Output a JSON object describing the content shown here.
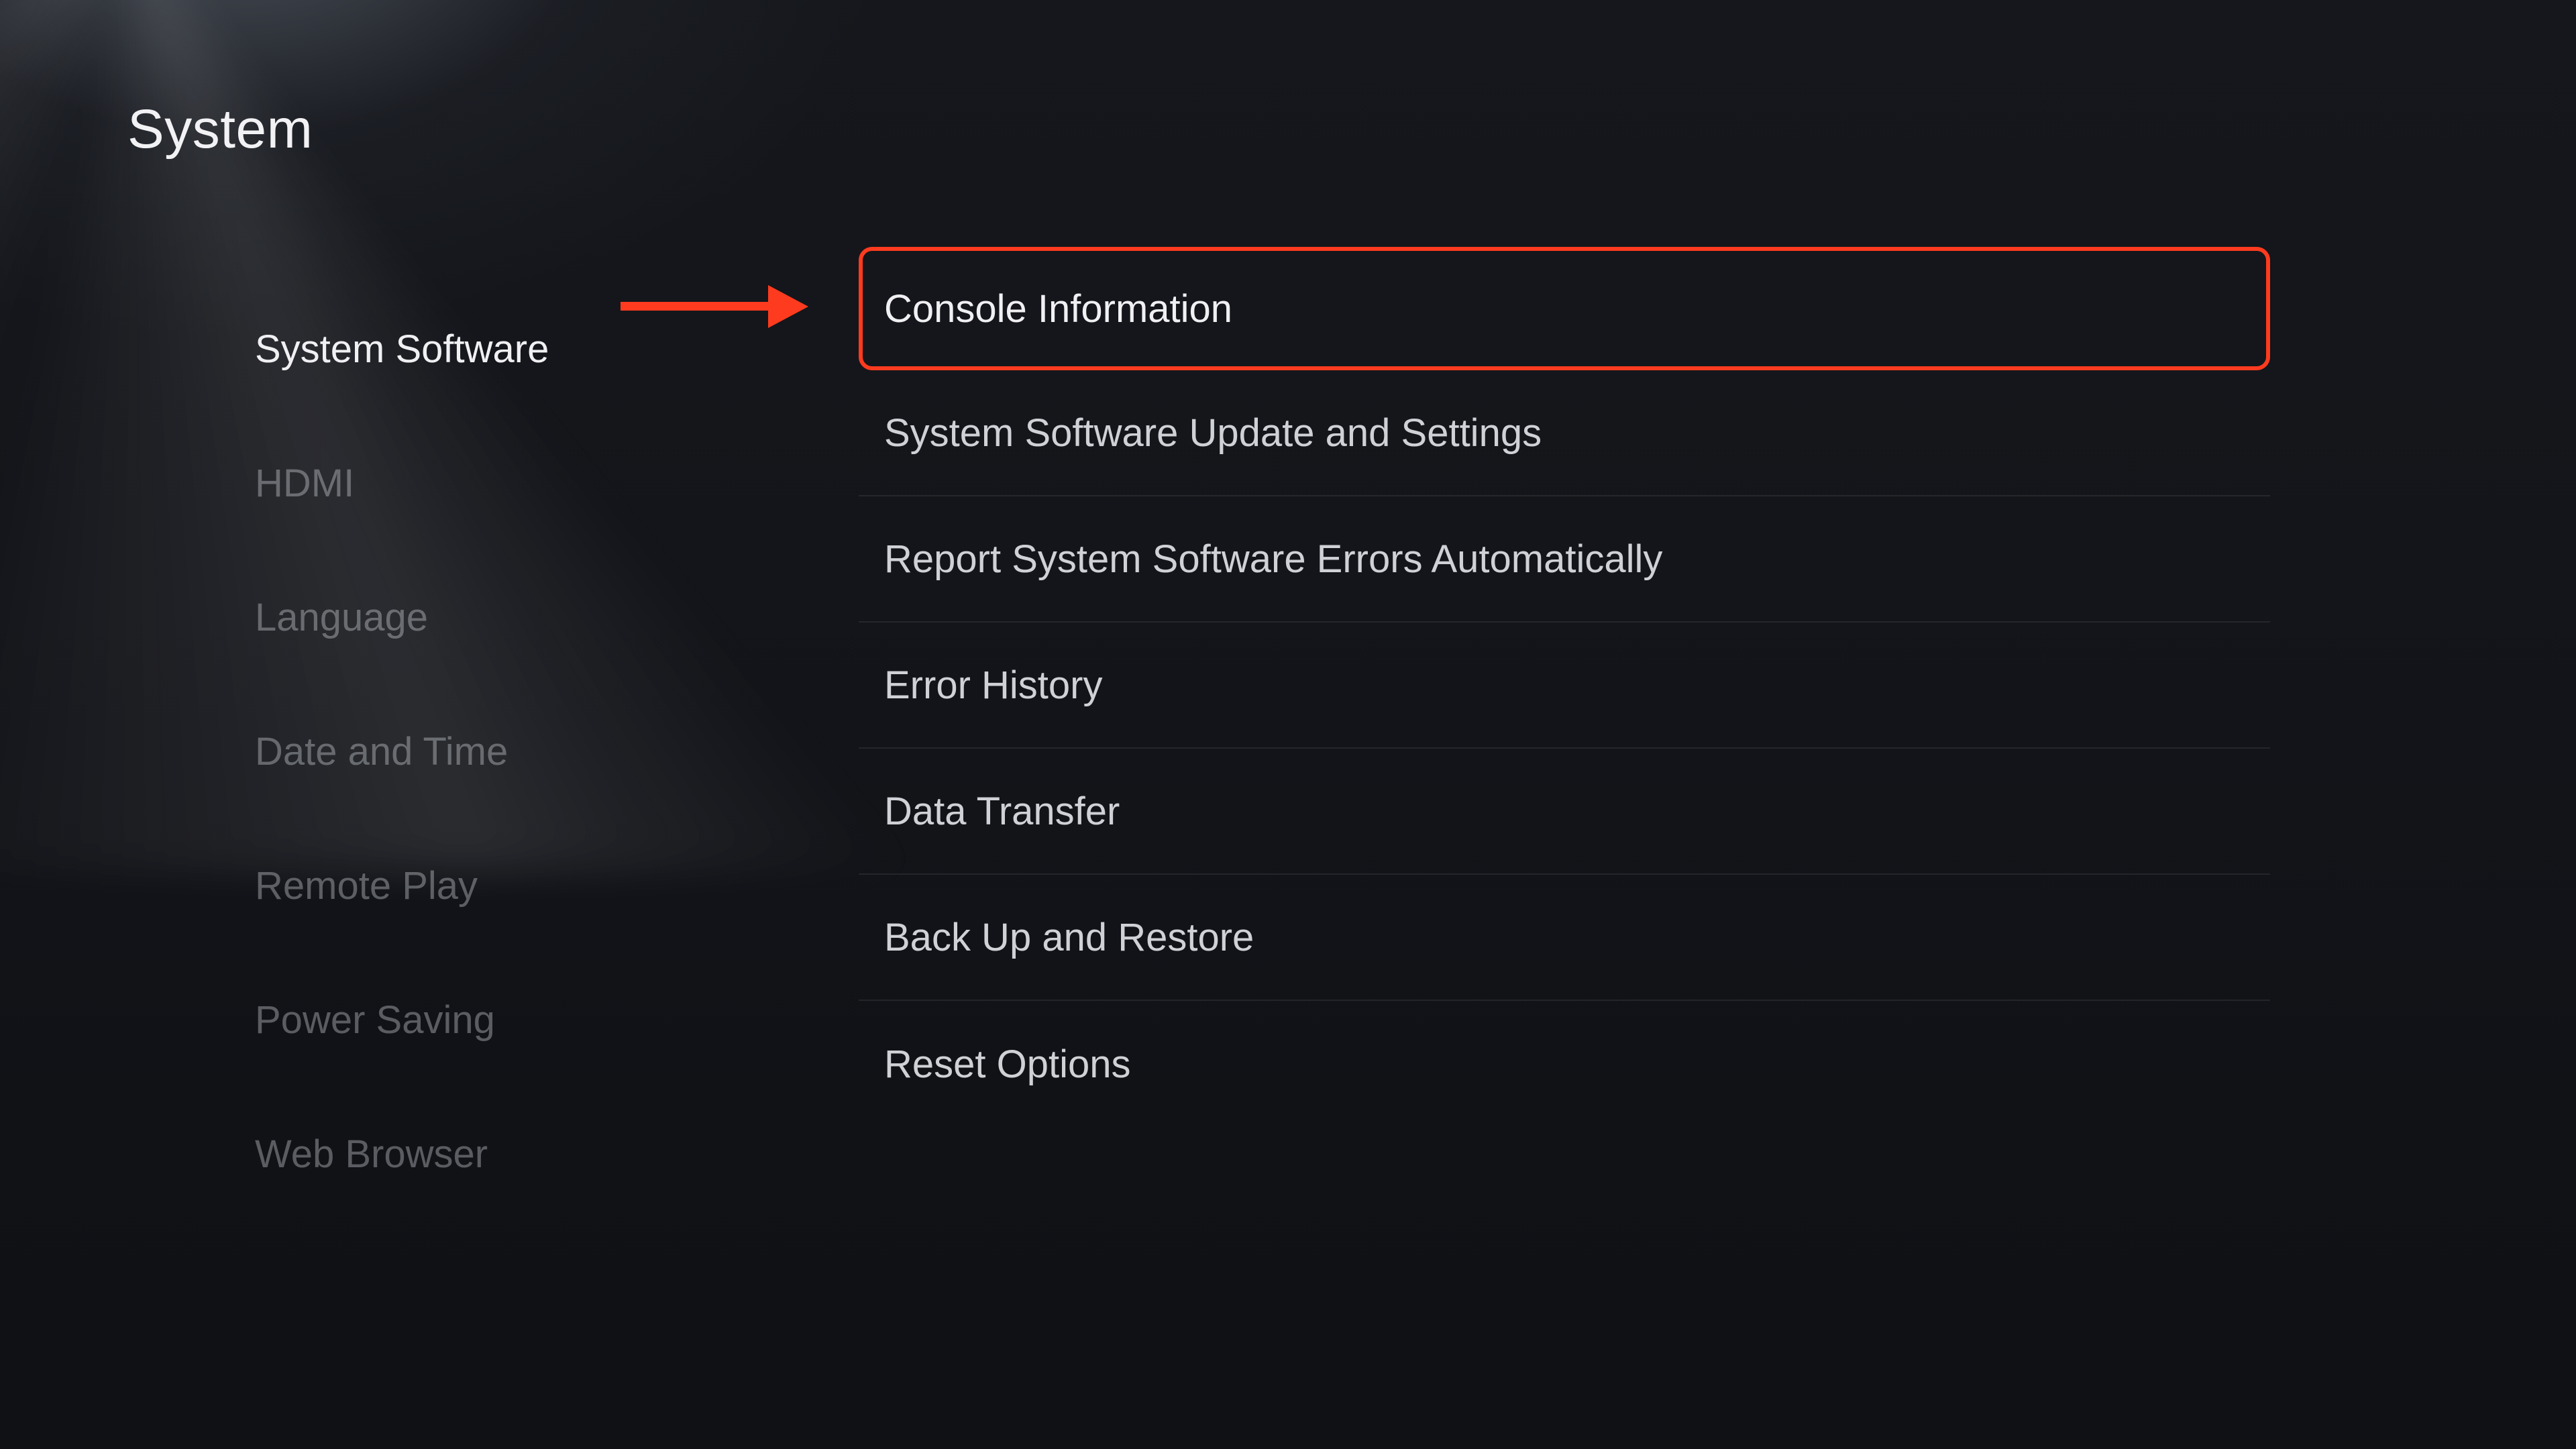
{
  "header": {
    "title": "System"
  },
  "sidebar": {
    "items": [
      {
        "label": "System Software",
        "active": true
      },
      {
        "label": "HDMI",
        "active": false
      },
      {
        "label": "Language",
        "active": false
      },
      {
        "label": "Date and Time",
        "active": false
      },
      {
        "label": "Remote Play",
        "active": false
      },
      {
        "label": "Power Saving",
        "active": false
      },
      {
        "label": "Web Browser",
        "active": false
      }
    ]
  },
  "main": {
    "items": [
      {
        "label": "Console Information",
        "highlight": true
      },
      {
        "label": "System Software Update and Settings",
        "highlight": false
      },
      {
        "label": "Report System Software Errors Automatically",
        "highlight": false
      },
      {
        "label": "Error History",
        "highlight": false
      },
      {
        "label": "Data Transfer",
        "highlight": false
      },
      {
        "label": "Back Up and Restore",
        "highlight": false
      },
      {
        "label": "Reset Options",
        "highlight": false
      }
    ]
  },
  "annotation": {
    "arrow_color": "#fe3b1f"
  }
}
